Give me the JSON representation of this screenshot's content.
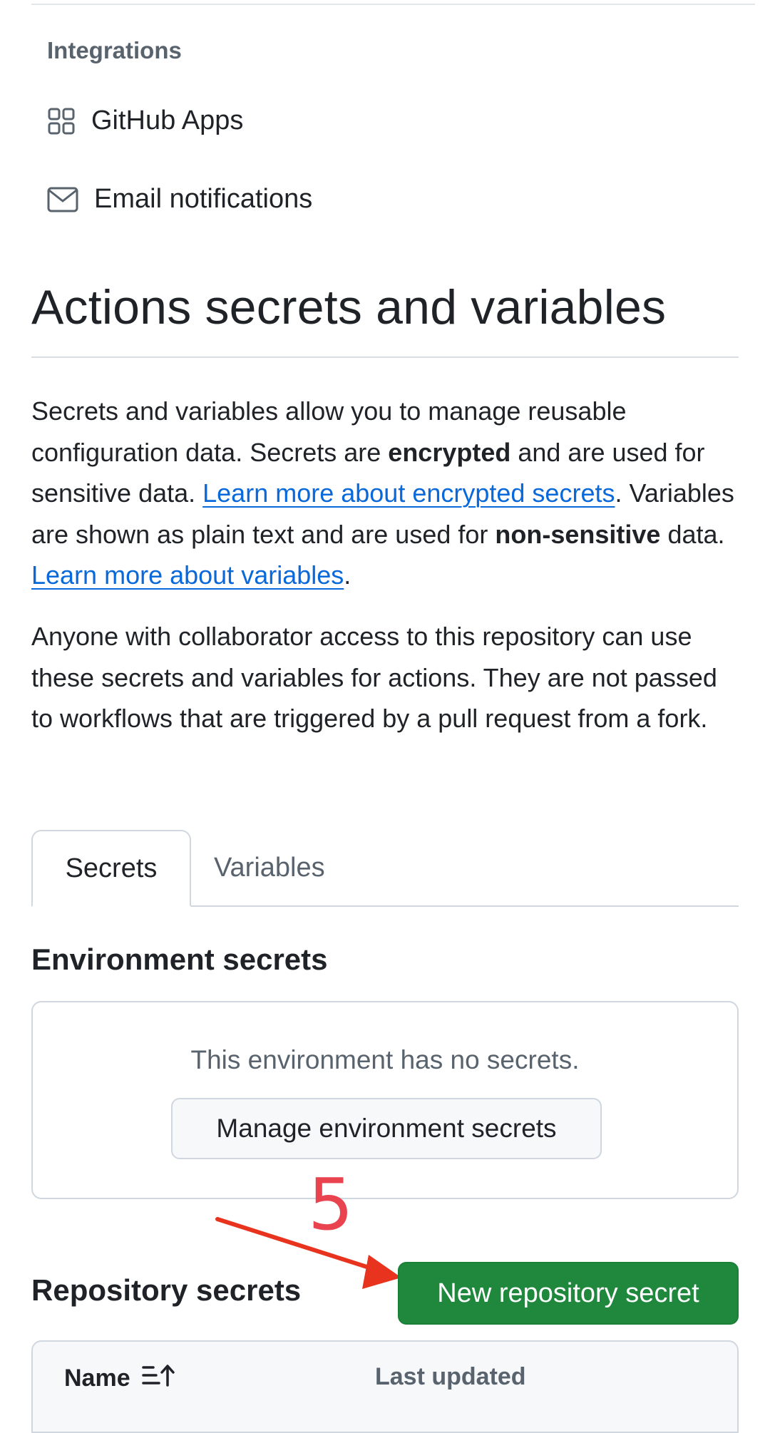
{
  "nav": {
    "section_header": "Integrations",
    "items": [
      {
        "label": "GitHub Apps",
        "icon": "apps-grid-icon"
      },
      {
        "label": "Email notifications",
        "icon": "mail-icon"
      }
    ]
  },
  "page": {
    "title": "Actions secrets and variables",
    "intro": {
      "t1": "Secrets and variables allow you to manage reusable configuration data. Secrets are ",
      "b1": "encrypted",
      "t2": " and are used for sensitive data. ",
      "link1": "Learn more about encrypted secrets",
      "t3": ". Variables are shown as plain text and are used for ",
      "b2": "non-sensitive",
      "t4": " data. ",
      "link2": "Learn more about variables",
      "t5": "."
    },
    "access_note": "Anyone with collaborator access to this repository can use these secrets and variables for actions. They are not passed to workflows that are triggered by a pull request from a fork."
  },
  "tabs": [
    {
      "label": "Secrets",
      "active": true
    },
    {
      "label": "Variables",
      "active": false
    }
  ],
  "environment_secrets": {
    "title": "Environment secrets",
    "empty_message": "This environment has no secrets.",
    "manage_button": "Manage environment secrets"
  },
  "repository_secrets": {
    "title": "Repository secrets",
    "new_button": "New repository secret",
    "columns": [
      "Name",
      "Last updated"
    ]
  },
  "annotation": {
    "step_number": "5",
    "color": "#e8434f"
  },
  "colors": {
    "primary_button": "#1f883d",
    "link": "#0969da",
    "muted_text": "#59636e",
    "border": "#d0d7de"
  }
}
